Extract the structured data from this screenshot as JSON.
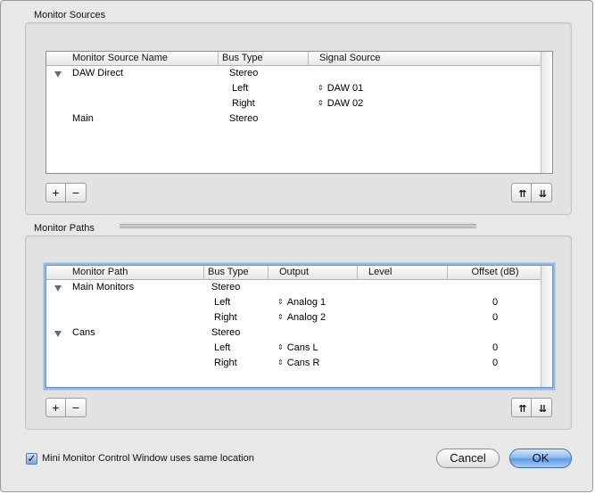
{
  "sources": {
    "title": "Monitor Sources",
    "columns": [
      "Monitor Source Name",
      "Bus Type",
      "Signal Source"
    ],
    "rows": [
      {
        "name": "DAW Direct",
        "bus": "Stereo",
        "signal": ""
      },
      {
        "name": "",
        "bus": "Left",
        "signal": "DAW 01"
      },
      {
        "name": "",
        "bus": "Right",
        "signal": "DAW 02"
      },
      {
        "name": "Main",
        "bus": "Stereo",
        "signal": ""
      }
    ],
    "add_label": "+",
    "remove_label": "−",
    "move_up_label": "⇈",
    "move_down_label": "⇊"
  },
  "paths": {
    "title": "Monitor Paths",
    "columns": [
      "Monitor Path",
      "Bus Type",
      "Output",
      "Level",
      "Offset (dB)"
    ],
    "rows": [
      {
        "name": "Main Monitors",
        "bus": "Stereo",
        "output": "",
        "offset": ""
      },
      {
        "name": "",
        "bus": "Left",
        "output": "Analog 1",
        "offset": "0"
      },
      {
        "name": "",
        "bus": "Right",
        "output": "Analog 2",
        "offset": "0"
      },
      {
        "name": "Cans",
        "bus": "Stereo",
        "output": "",
        "offset": ""
      },
      {
        "name": "",
        "bus": "Left",
        "output": "Cans L",
        "offset": "0"
      },
      {
        "name": "",
        "bus": "Right",
        "output": "Cans R",
        "offset": "0"
      }
    ],
    "add_label": "+",
    "remove_label": "−",
    "move_up_label": "⇈",
    "move_down_label": "⇊"
  },
  "options": {
    "mini_window_label": "Mini Monitor Control Window uses same location",
    "mini_window_checked": true
  },
  "buttons": {
    "cancel": "Cancel",
    "ok": "OK"
  },
  "colors": {
    "accent": "#6b93c9",
    "ok_button": "#5f9be5"
  },
  "icons": {
    "updown": "⇕",
    "check": "✓"
  }
}
